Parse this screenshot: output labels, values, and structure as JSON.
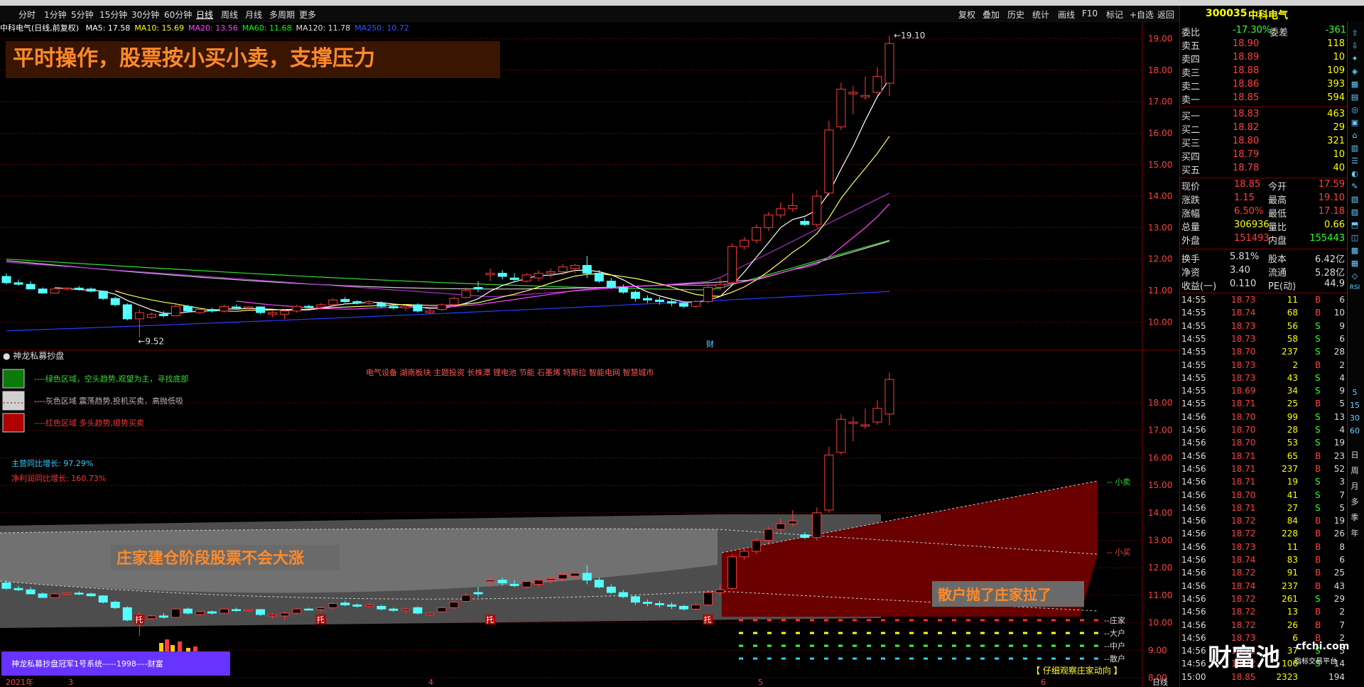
{
  "toolbar": {
    "tabs": [
      "分时",
      "1分钟",
      "5分钟",
      "15分钟",
      "30分钟",
      "60分钟",
      "日线",
      "周线",
      "月线",
      "多周期",
      "更多"
    ],
    "selected": "日线",
    "right_buttons": [
      "复权",
      "叠加",
      "历史",
      "统计",
      "画线",
      "F10",
      "标记",
      "+自选",
      "返回"
    ]
  },
  "header": {
    "stock_name": "中科电气(日线,前复权)",
    "ma": [
      {
        "label": "MA5: 17.58",
        "color": "#ffffff"
      },
      {
        "label": "MA10: 15.69",
        "color": "#ffff00"
      },
      {
        "label": "MA20: 13.56",
        "color": "#ff44ff"
      },
      {
        "label": "MA60: 11.68",
        "color": "#00ff00"
      },
      {
        "label": "MA120: 11.78",
        "color": "#dddddd"
      },
      {
        "label": "MA250: 10.72",
        "color": "#3355ff"
      }
    ]
  },
  "annotations": {
    "top_banner": "平时操作，股票按小买小卖，支撑压力",
    "mid_banner": "庄家建仓阶段股票不会大涨",
    "right_banner": "散户抛了庄家拉了",
    "high_label": "19.10",
    "low_label": "9.52",
    "cai_label": "财",
    "tuo": "托"
  },
  "indicator": {
    "title": "神龙私募抄盘",
    "legend": [
      {
        "text": "----绿色区域，空头趋势,观望为主，寻找底部",
        "box": "#0a7a0a",
        "color": "#33dd33"
      },
      {
        "text": "----灰色区域 震荡趋势,投机买卖，高抛低吸",
        "box": "#d0d0d0",
        "color": "#bbbbbb"
      },
      {
        "text": "----红色区域 多头趋势,顺势买卖",
        "box": "#b00000",
        "color": "#ff3333"
      }
    ],
    "sectors": "电气设备 湖南板块 主题投资 长株潭 锂电池 节能 石墨烯 特斯拉 智能电网 智慧城市",
    "revenue_growth": "主营同比增长: 97.29%",
    "profit_growth": "净利润同比增长: 160.73%",
    "small_sell": "小卖",
    "small_buy": "小买",
    "holders": [
      "庄家",
      "大户",
      "中户",
      "散户"
    ],
    "promo": "神龙私募抄盘冠军1号系统-----1998----财富",
    "watch": "【 仔细观察庄家动向 】"
  },
  "axes": {
    "main_y": [
      "19.00",
      "18.00",
      "17.00",
      "16.00",
      "15.00",
      "14.00",
      "13.00",
      "12.00",
      "11.00",
      "10.00"
    ],
    "sub_y": [
      "18.00",
      "17.00",
      "16.00",
      "15.00",
      "14.00",
      "13.00",
      "12.00",
      "11.00",
      "10.00",
      "9.00",
      "8.00"
    ],
    "x": [
      "2021年",
      "3",
      "4",
      "5",
      "6"
    ],
    "period": "日线"
  },
  "quote": {
    "code": "300035",
    "name": "中科电气",
    "weibi_label": "委比",
    "weibi": "-17.30%",
    "weicha_label": "委差",
    "weicha": "-361",
    "sells": [
      {
        "label": "卖五",
        "price": "18.90",
        "vol": "118"
      },
      {
        "label": "卖四",
        "price": "18.89",
        "vol": "10"
      },
      {
        "label": "卖三",
        "price": "18.88",
        "vol": "109"
      },
      {
        "label": "卖二",
        "price": "18.86",
        "vol": "393"
      },
      {
        "label": "卖一",
        "price": "18.85",
        "vol": "594"
      }
    ],
    "buys": [
      {
        "label": "买一",
        "price": "18.83",
        "vol": "463"
      },
      {
        "label": "买二",
        "price": "18.82",
        "vol": "29"
      },
      {
        "label": "买三",
        "price": "18.80",
        "vol": "321"
      },
      {
        "label": "买四",
        "price": "18.79",
        "vol": "10"
      },
      {
        "label": "买五",
        "price": "18.78",
        "vol": "40"
      }
    ],
    "stats": [
      {
        "l1": "现价",
        "v1": "18.85",
        "c1": "#ff4040",
        "l2": "今开",
        "v2": "17.59",
        "c2": "#ff4040"
      },
      {
        "l1": "涨跌",
        "v1": "1.15",
        "c1": "#ff4040",
        "l2": "最高",
        "v2": "19.10",
        "c2": "#ff4040"
      },
      {
        "l1": "涨幅",
        "v1": "6.50%",
        "c1": "#ff4040",
        "l2": "最低",
        "v2": "17.18",
        "c2": "#ff4040"
      },
      {
        "l1": "总量",
        "v1": "306936",
        "c1": "#ffff00",
        "l2": "量比",
        "v2": "0.66",
        "c2": "#ffff00"
      },
      {
        "l1": "外盘",
        "v1": "151493",
        "c1": "#ff4040",
        "l2": "内盘",
        "v2": "155443",
        "c2": "#33ff33"
      }
    ],
    "fin": [
      {
        "l1": "换手",
        "v1": "5.81%",
        "l2": "股本",
        "v2": "6.42亿"
      },
      {
        "l1": "净资",
        "v1": "3.40",
        "l2": "流通",
        "v2": "5.28亿"
      },
      {
        "l1": "收益(一)",
        "v1": "0.110",
        "l2": "PE(动)",
        "v2": "44.9"
      }
    ]
  },
  "ticks": [
    [
      "14:55",
      "18.73",
      "11",
      "B",
      "6"
    ],
    [
      "14:55",
      "18.74",
      "68",
      "B",
      "10"
    ],
    [
      "14:55",
      "18.73",
      "56",
      "S",
      "9"
    ],
    [
      "14:55",
      "18.73",
      "58",
      "S",
      "6"
    ],
    [
      "14:55",
      "18.70",
      "237",
      "S",
      "28"
    ],
    [
      "14:55",
      "18.73",
      "2",
      "B",
      "2"
    ],
    [
      "14:55",
      "18.73",
      "43",
      "S",
      "4"
    ],
    [
      "14:55",
      "18.69",
      "34",
      "S",
      "9"
    ],
    [
      "14:55",
      "18.71",
      "25",
      "B",
      "5"
    ],
    [
      "14:56",
      "18.70",
      "99",
      "S",
      "13"
    ],
    [
      "14:56",
      "18.70",
      "28",
      "S",
      "4"
    ],
    [
      "14:56",
      "18.70",
      "53",
      "S",
      "19"
    ],
    [
      "14:56",
      "18.71",
      "65",
      "B",
      "23"
    ],
    [
      "14:56",
      "18.71",
      "237",
      "B",
      "52"
    ],
    [
      "14:56",
      "18.71",
      "19",
      "S",
      "3"
    ],
    [
      "14:56",
      "18.70",
      "41",
      "S",
      "7"
    ],
    [
      "14:56",
      "18.71",
      "27",
      "S",
      "5"
    ],
    [
      "14:56",
      "18.72",
      "84",
      "B",
      "19"
    ],
    [
      "14:56",
      "18.72",
      "228",
      "B",
      "26"
    ],
    [
      "14:56",
      "18.73",
      "11",
      "B",
      "8"
    ],
    [
      "14:56",
      "18.74",
      "83",
      "B",
      "6"
    ],
    [
      "14:56",
      "18.72",
      "91",
      "B",
      "25"
    ],
    [
      "14:56",
      "18.74",
      "237",
      "B",
      "43"
    ],
    [
      "14:56",
      "18.72",
      "261",
      "S",
      "29"
    ],
    [
      "14:56",
      "18.72",
      "13",
      "B",
      "2"
    ],
    [
      "14:56",
      "18.72",
      "26",
      "B",
      "7"
    ],
    [
      "14:56",
      "18.73",
      "6",
      "B",
      "2"
    ],
    [
      "14:56",
      "18.72",
      "37",
      "S",
      "5"
    ],
    [
      "14:56",
      "18.72",
      "106",
      "S",
      "14"
    ],
    [
      "15:00",
      "18.85",
      "2323",
      "",
      "194"
    ]
  ],
  "side_icons": [
    "日",
    "周",
    "月",
    "多",
    "季",
    "年"
  ],
  "watermark": {
    "logo": "财富池",
    "site": "cfchi.com",
    "slogan": "指标交易平台"
  },
  "colors": {
    "up": "#ff3c3c",
    "down": "#54ffff",
    "grid": "#6a0000"
  },
  "chart_data": {
    "type": "candlestick",
    "ylim": [
      9.4,
      19.3
    ],
    "ma_series_names": [
      "MA5",
      "MA10",
      "MA20",
      "MA60",
      "MA120",
      "MA250"
    ],
    "ohlc": [
      [
        11.45,
        11.55,
        11.2,
        11.25
      ],
      [
        11.25,
        11.35,
        11.15,
        11.2
      ],
      [
        11.2,
        11.3,
        11.05,
        11.05
      ],
      [
        11.05,
        11.1,
        10.9,
        10.92
      ],
      [
        10.92,
        11.1,
        10.9,
        11.05
      ],
      [
        11.05,
        11.1,
        11.0,
        11.08
      ],
      [
        11.08,
        11.15,
        11.0,
        11.05
      ],
      [
        11.05,
        11.1,
        10.95,
        10.98
      ],
      [
        10.98,
        11.0,
        10.7,
        10.75
      ],
      [
        10.75,
        10.8,
        10.5,
        10.55
      ],
      [
        10.55,
        10.6,
        10.05,
        10.1
      ],
      [
        10.1,
        10.4,
        9.52,
        10.3
      ],
      [
        10.15,
        10.3,
        10.1,
        10.25
      ],
      [
        10.25,
        10.35,
        10.15,
        10.2
      ],
      [
        10.2,
        10.55,
        10.2,
        10.5
      ],
      [
        10.5,
        10.55,
        10.3,
        10.35
      ],
      [
        10.3,
        10.45,
        10.25,
        10.4
      ],
      [
        10.4,
        10.45,
        10.3,
        10.35
      ],
      [
        10.35,
        10.55,
        10.3,
        10.5
      ],
      [
        10.48,
        10.55,
        10.4,
        10.45
      ],
      [
        10.45,
        10.5,
        10.4,
        10.48
      ],
      [
        10.48,
        10.5,
        10.25,
        10.3
      ],
      [
        10.25,
        10.35,
        10.15,
        10.3
      ],
      [
        10.25,
        10.4,
        10.1,
        10.35
      ],
      [
        10.35,
        10.55,
        10.3,
        10.5
      ],
      [
        10.5,
        10.55,
        10.45,
        10.48
      ],
      [
        10.48,
        10.6,
        10.4,
        10.55
      ],
      [
        10.55,
        10.75,
        10.5,
        10.7
      ],
      [
        10.72,
        10.8,
        10.6,
        10.65
      ],
      [
        10.65,
        10.7,
        10.55,
        10.6
      ],
      [
        10.6,
        10.7,
        10.55,
        10.65
      ],
      [
        10.6,
        10.65,
        10.45,
        10.5
      ],
      [
        10.5,
        10.55,
        10.4,
        10.45
      ],
      [
        10.45,
        10.55,
        10.35,
        10.5
      ],
      [
        10.55,
        10.6,
        10.3,
        10.35
      ],
      [
        10.3,
        10.4,
        10.25,
        10.35
      ],
      [
        10.4,
        10.6,
        10.35,
        10.55
      ],
      [
        10.55,
        10.8,
        10.5,
        10.75
      ],
      [
        10.78,
        11.1,
        10.75,
        11.0
      ],
      [
        11.1,
        11.3,
        10.95,
        11.05
      ],
      [
        11.5,
        11.7,
        11.3,
        11.55
      ],
      [
        11.55,
        11.65,
        11.35,
        11.45
      ],
      [
        11.4,
        11.55,
        11.3,
        11.35
      ],
      [
        11.3,
        11.55,
        11.25,
        11.5
      ],
      [
        11.4,
        11.65,
        11.3,
        11.55
      ],
      [
        11.55,
        11.7,
        11.4,
        11.6
      ],
      [
        11.6,
        11.85,
        11.5,
        11.75
      ],
      [
        11.7,
        11.85,
        11.55,
        11.8
      ],
      [
        11.8,
        12.1,
        11.4,
        11.55
      ],
      [
        11.55,
        11.65,
        11.25,
        11.3
      ],
      [
        11.3,
        11.4,
        11.05,
        11.1
      ],
      [
        11.1,
        11.2,
        10.9,
        10.95
      ],
      [
        10.95,
        11.0,
        10.65,
        10.75
      ],
      [
        10.75,
        10.85,
        10.6,
        10.7
      ],
      [
        10.7,
        10.8,
        10.55,
        10.65
      ],
      [
        10.65,
        10.75,
        10.5,
        10.6
      ],
      [
        10.6,
        10.65,
        10.45,
        10.5
      ],
      [
        10.5,
        10.7,
        10.45,
        10.65
      ],
      [
        10.65,
        11.2,
        10.6,
        11.1
      ],
      [
        11.1,
        11.4,
        11.0,
        11.2
      ],
      [
        11.25,
        12.5,
        11.2,
        12.4
      ],
      [
        12.4,
        12.7,
        12.3,
        12.6
      ],
      [
        12.6,
        13.1,
        12.5,
        13.0
      ],
      [
        13.0,
        13.5,
        12.9,
        13.4
      ],
      [
        13.4,
        13.8,
        13.3,
        13.6
      ],
      [
        13.6,
        14.1,
        13.5,
        13.7
      ],
      [
        13.2,
        13.3,
        13.05,
        13.1
      ],
      [
        13.1,
        14.2,
        13.0,
        14.0
      ],
      [
        14.1,
        16.4,
        14.0,
        16.1
      ],
      [
        16.2,
        17.6,
        16.1,
        17.4
      ],
      [
        17.25,
        17.5,
        16.6,
        17.3
      ],
      [
        17.15,
        17.8,
        17.05,
        17.2
      ],
      [
        17.3,
        18.1,
        17.2,
        17.8
      ],
      [
        17.59,
        19.1,
        17.18,
        18.85
      ]
    ]
  }
}
